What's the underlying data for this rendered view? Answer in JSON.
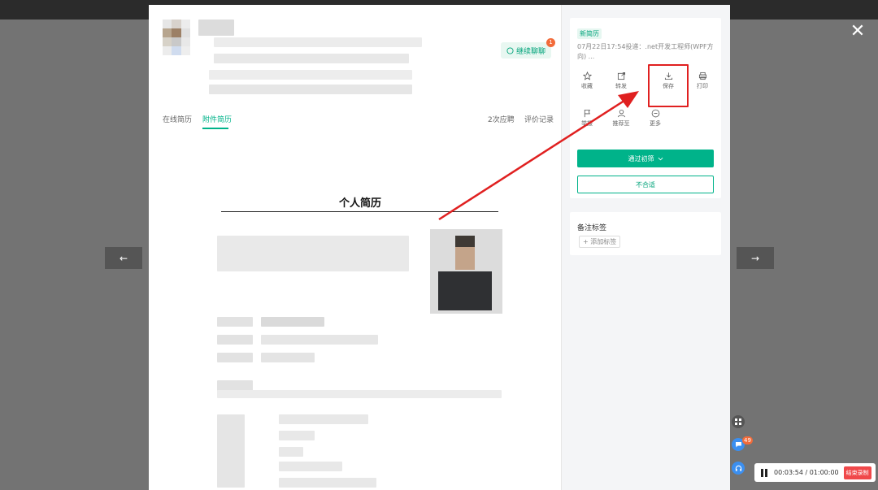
{
  "window": {
    "close_glyph": "✕",
    "prev_glyph": "←",
    "next_glyph": "→"
  },
  "candidate": {
    "chat_button_label": "继续聊聊",
    "chat_badge": "1"
  },
  "tabs": {
    "online": "在线简历",
    "attachment": "附件简历",
    "apply_count": "2次应聘",
    "evaluation": "评价记录"
  },
  "resume": {
    "title": "个人简历"
  },
  "sidebar": {
    "new_tag": "新简历",
    "apply_info": "07月22日17:54投递：.net开发工程师(WPF方向) ...",
    "actions": [
      {
        "label": "收藏",
        "icon": "star-icon"
      },
      {
        "label": "转发",
        "icon": "share-icon"
      },
      {
        "label": "保存",
        "icon": "download-icon"
      },
      {
        "label": "打印",
        "icon": "print-icon"
      },
      {
        "label": "举报",
        "icon": "report-icon"
      },
      {
        "label": "推荐至",
        "icon": "recommend-icon"
      },
      {
        "label": "更多",
        "icon": "more-icon"
      }
    ],
    "pass_button": "通过初筛",
    "reject_button": "不合适",
    "note_title": "备注标签",
    "add_tag": "+ 添加标签"
  },
  "floating": {
    "message_badge": "49"
  },
  "recorder": {
    "time": "00:03:54 / 01:00:00",
    "stop_label": "结束录制"
  },
  "colors": {
    "accent": "#00b38a",
    "highlight": "#e02020",
    "overlay": "#737373"
  }
}
